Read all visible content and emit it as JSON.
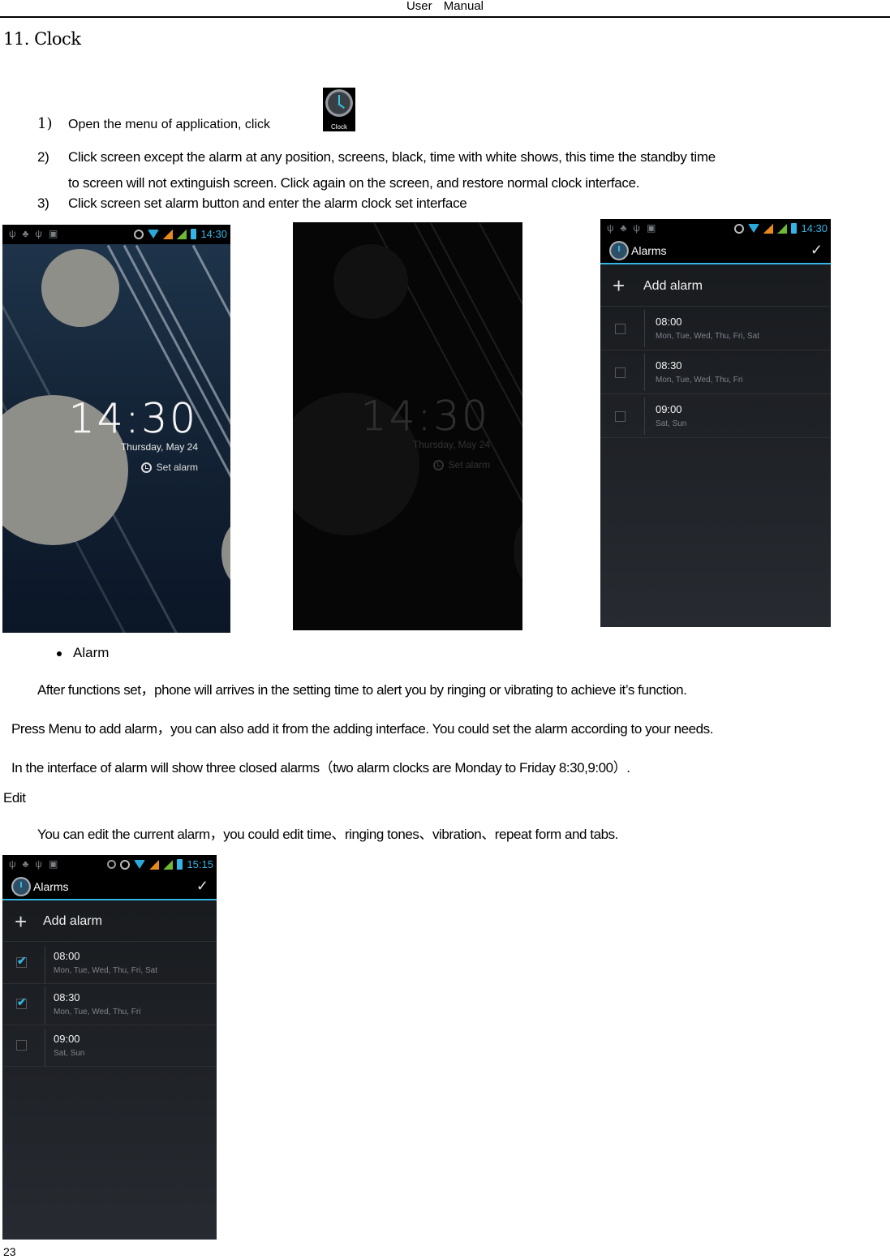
{
  "header": {
    "title": "User Manual"
  },
  "section": {
    "title": "11. Clock"
  },
  "steps": [
    {
      "num": "1)",
      "text": "Open the menu of application, click",
      "icon_label": "Clock"
    },
    {
      "num": "2)",
      "text": "Click screen except the alarm at any position, screens, black, time with white shows, this time the standby time",
      "text_cont": "to screen will not extinguish screen. Click again on the screen, and restore normal clock interface."
    },
    {
      "num": "3)",
      "text": "Click screen set alarm button and enter the alarm clock set interface"
    }
  ],
  "lockscreen": {
    "time": "14:30",
    "date": "Thursday, May 24",
    "set_alarm": "Set alarm",
    "status_time": "14:30"
  },
  "lockscreen_dim": {
    "time": "14:30",
    "date": "Thursday, May 24",
    "set_alarm": "Set alarm"
  },
  "alarms_screen_1": {
    "status_time": "14:30",
    "title": "Alarms",
    "add_label": "Add alarm",
    "items": [
      {
        "time": "08:00",
        "days": "Mon, Tue, Wed, Thu, Fri, Sat",
        "enabled": false
      },
      {
        "time": "08:30",
        "days": "Mon, Tue, Wed, Thu, Fri",
        "enabled": false
      },
      {
        "time": "09:00",
        "days": "Sat, Sun",
        "enabled": false
      }
    ]
  },
  "alarms_screen_2": {
    "status_time": "15:15",
    "title": "Alarms",
    "add_label": "Add alarm",
    "items": [
      {
        "time": "08:00",
        "days": "Mon, Tue, Wed, Thu, Fri, Sat",
        "enabled": true
      },
      {
        "time": "08:30",
        "days": "Mon, Tue, Wed, Thu, Fri",
        "enabled": true
      },
      {
        "time": "09:00",
        "days": "Sat, Sun",
        "enabled": false
      }
    ]
  },
  "body": {
    "bullet": "Alarm",
    "p1": "After functions set，phone will arrives in the setting time to alert you by ringing or vibrating to achieve it’s function.",
    "p2": "Press Menu to add alarm，you can also add it from the adding interface. You could set the alarm according to your needs.",
    "p3": "In the interface of alarm will show three closed alarms（two alarm clocks are Monday to Friday 8:30,9:00）.",
    "p4": "Edit",
    "p5": "You can edit the current alarm，you could edit time、ringing tones、vibration、repeat form and tabs."
  },
  "footer": {
    "page_number": "23"
  }
}
